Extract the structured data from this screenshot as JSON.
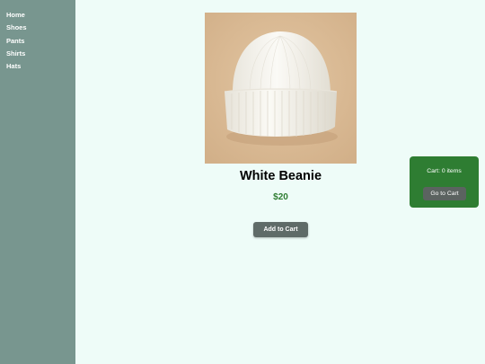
{
  "sidebar": {
    "items": [
      {
        "label": "Home"
      },
      {
        "label": "Shoes"
      },
      {
        "label": "Pants"
      },
      {
        "label": "Shirts"
      },
      {
        "label": "Hats"
      }
    ]
  },
  "product": {
    "image_icon": "white-beanie-photo",
    "title": "White Beanie",
    "price": "$20",
    "add_label": "Add to Cart"
  },
  "cart": {
    "count_text": "Cart: 0 items",
    "button_label": "Go to Cart"
  },
  "colors": {
    "page_bg": "#eefcf8",
    "sidebar_bg": "#78968f",
    "price": "#2e7d32",
    "cart_bg": "#2e7d32",
    "button_bg": "#5f6b68"
  }
}
